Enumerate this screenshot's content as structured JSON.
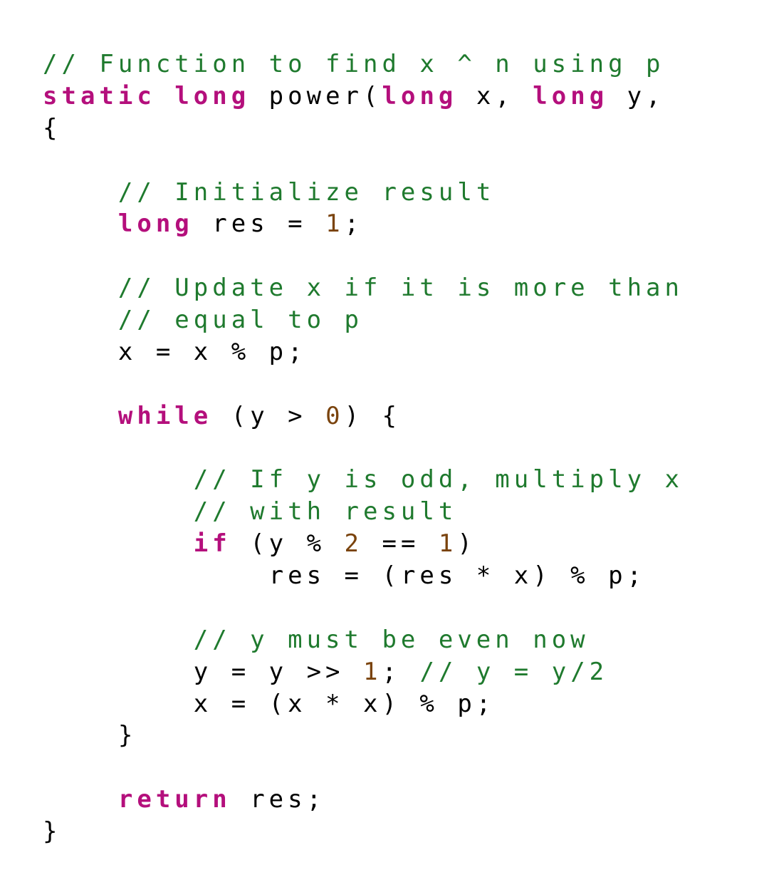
{
  "language": "java",
  "tokens": [
    {
      "cls": "c",
      "text": "// Function to find x ^ n using p"
    },
    {
      "cls": "t",
      "text": "\n"
    },
    {
      "cls": "k",
      "text": "static"
    },
    {
      "cls": "t",
      "text": " "
    },
    {
      "cls": "k",
      "text": "long"
    },
    {
      "cls": "t",
      "text": " power("
    },
    {
      "cls": "k",
      "text": "long"
    },
    {
      "cls": "t",
      "text": " x, "
    },
    {
      "cls": "k",
      "text": "long"
    },
    {
      "cls": "t",
      "text": " y, "
    },
    {
      "cls": "t",
      "text": "\n"
    },
    {
      "cls": "t",
      "text": "{"
    },
    {
      "cls": "t",
      "text": "\n"
    },
    {
      "cls": "t",
      "text": "\n"
    },
    {
      "cls": "t",
      "text": "    "
    },
    {
      "cls": "c",
      "text": "// Initialize result"
    },
    {
      "cls": "t",
      "text": "\n"
    },
    {
      "cls": "t",
      "text": "    "
    },
    {
      "cls": "k",
      "text": "long"
    },
    {
      "cls": "t",
      "text": " res = "
    },
    {
      "cls": "n",
      "text": "1"
    },
    {
      "cls": "t",
      "text": ";"
    },
    {
      "cls": "t",
      "text": "\n"
    },
    {
      "cls": "t",
      "text": "\n"
    },
    {
      "cls": "t",
      "text": "    "
    },
    {
      "cls": "c",
      "text": "// Update x if it is more than"
    },
    {
      "cls": "t",
      "text": "\n"
    },
    {
      "cls": "t",
      "text": "    "
    },
    {
      "cls": "c",
      "text": "// equal to p"
    },
    {
      "cls": "t",
      "text": "\n"
    },
    {
      "cls": "t",
      "text": "    x = x % p;"
    },
    {
      "cls": "t",
      "text": "\n"
    },
    {
      "cls": "t",
      "text": "\n"
    },
    {
      "cls": "t",
      "text": "    "
    },
    {
      "cls": "k",
      "text": "while"
    },
    {
      "cls": "t",
      "text": " (y > "
    },
    {
      "cls": "n",
      "text": "0"
    },
    {
      "cls": "t",
      "text": ") {"
    },
    {
      "cls": "t",
      "text": "\n"
    },
    {
      "cls": "t",
      "text": "\n"
    },
    {
      "cls": "t",
      "text": "        "
    },
    {
      "cls": "c",
      "text": "// If y is odd, multiply x"
    },
    {
      "cls": "t",
      "text": "\n"
    },
    {
      "cls": "t",
      "text": "        "
    },
    {
      "cls": "c",
      "text": "// with result"
    },
    {
      "cls": "t",
      "text": "\n"
    },
    {
      "cls": "t",
      "text": "        "
    },
    {
      "cls": "k",
      "text": "if"
    },
    {
      "cls": "t",
      "text": " (y % "
    },
    {
      "cls": "n",
      "text": "2"
    },
    {
      "cls": "t",
      "text": " == "
    },
    {
      "cls": "n",
      "text": "1"
    },
    {
      "cls": "t",
      "text": ")"
    },
    {
      "cls": "t",
      "text": "\n"
    },
    {
      "cls": "t",
      "text": "            res = (res * x) % p;"
    },
    {
      "cls": "t",
      "text": "\n"
    },
    {
      "cls": "t",
      "text": "\n"
    },
    {
      "cls": "t",
      "text": "        "
    },
    {
      "cls": "c",
      "text": "// y must be even now"
    },
    {
      "cls": "t",
      "text": "\n"
    },
    {
      "cls": "t",
      "text": "        y = y >> "
    },
    {
      "cls": "n",
      "text": "1"
    },
    {
      "cls": "t",
      "text": "; "
    },
    {
      "cls": "c",
      "text": "// y = y/2"
    },
    {
      "cls": "t",
      "text": "\n"
    },
    {
      "cls": "t",
      "text": "        x = (x * x) % p;"
    },
    {
      "cls": "t",
      "text": "\n"
    },
    {
      "cls": "t",
      "text": "    }"
    },
    {
      "cls": "t",
      "text": "\n"
    },
    {
      "cls": "t",
      "text": "\n"
    },
    {
      "cls": "t",
      "text": "    "
    },
    {
      "cls": "k",
      "text": "return"
    },
    {
      "cls": "t",
      "text": " res;"
    },
    {
      "cls": "t",
      "text": "\n"
    },
    {
      "cls": "t",
      "text": "}"
    }
  ]
}
